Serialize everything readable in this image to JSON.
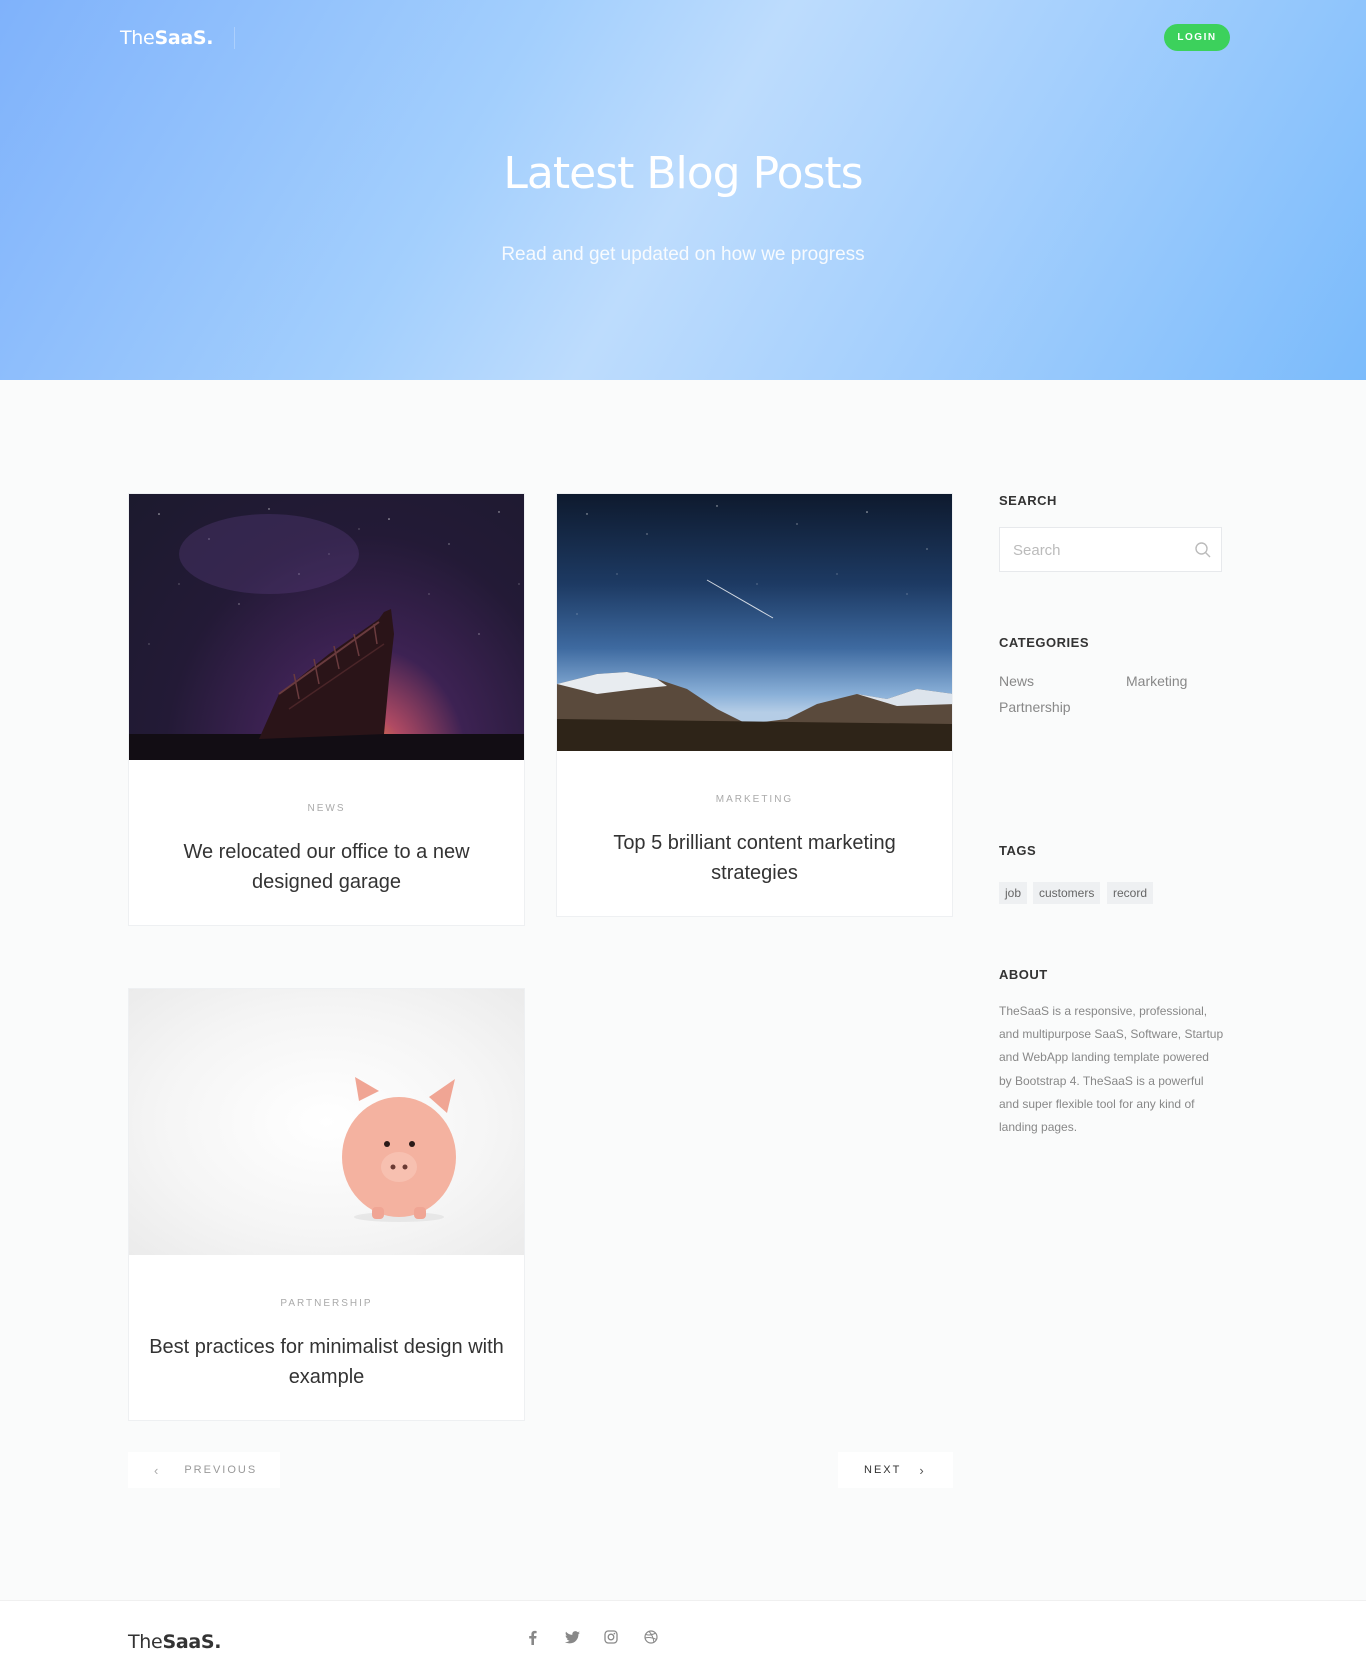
{
  "header": {
    "logo_the": "The",
    "logo_saas": "SaaS.",
    "login_label": "LOGIN"
  },
  "hero": {
    "title": "Latest Blog Posts",
    "subtitle": "Read and get updated on how we progress"
  },
  "posts": [
    {
      "category": "NEWS",
      "title": "We relocated our office to a new designed garage",
      "image": "boat-under-starry-sky"
    },
    {
      "category": "MARKETING",
      "title": "Top 5 brilliant content marketing strategies",
      "image": "mountains-under-night-sky"
    },
    {
      "category": "PARTNERSHIP",
      "title": "Best practices for minimalist design with example",
      "image": "pink-piggy-bank"
    }
  ],
  "pagination": {
    "previous_label": "PREVIOUS",
    "next_label": "NEXT"
  },
  "sidebar": {
    "search_heading": "SEARCH",
    "search_placeholder": "Search",
    "categories_heading": "CATEGORIES",
    "categories": [
      "News",
      "Marketing",
      "Partnership"
    ],
    "tags_heading": "TAGS",
    "tags": [
      "job",
      "customers",
      "record"
    ],
    "about_heading": "ABOUT",
    "about_text": "TheSaaS is a responsive, professional, and multipurpose SaaS, Software, Startup and WebApp landing template powered by Bootstrap 4. TheSaaS is a powerful and super flexible tool for any kind of landing pages."
  },
  "footer": {
    "logo_the": "The",
    "logo_saas": "SaaS.",
    "social_icons": [
      "facebook-icon",
      "twitter-icon",
      "instagram-icon",
      "dribbble-icon"
    ]
  },
  "colors": {
    "accent_login": "#3cd15c",
    "hero_gradient_start": "#7fb2fb",
    "hero_gradient_end": "#7bbbfb"
  }
}
